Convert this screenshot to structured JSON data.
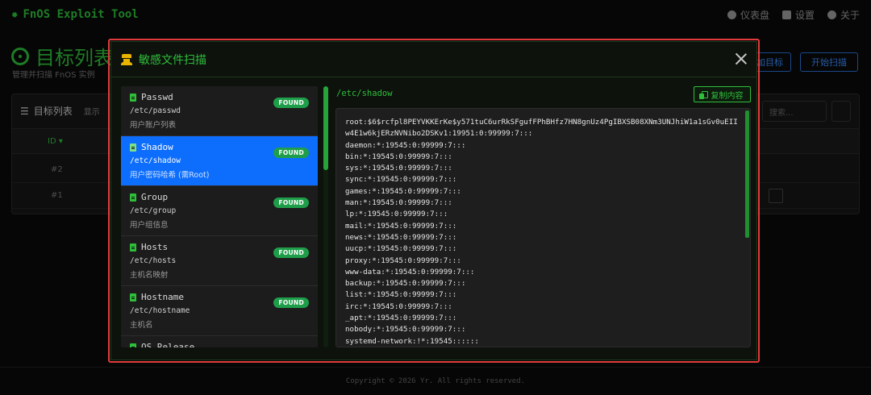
{
  "app": {
    "brand": "FnOS Exploit Tool",
    "nav": [
      {
        "label": "仪表盘",
        "icon": "dashboard-icon"
      },
      {
        "label": "设置",
        "icon": "gear-icon"
      },
      {
        "label": "关于",
        "icon": "info-icon"
      }
    ]
  },
  "page": {
    "title": "目标列表",
    "subtitle": "管理并扫描 FnOS 实例",
    "add_target_button": "添加目标",
    "start_scan_button": "开始扫描"
  },
  "panel": {
    "title": "目标列表",
    "show_label": "显示",
    "search_placeholder": "搜索...",
    "id_header": "ID ▾",
    "rows": [
      "#2",
      "#1"
    ]
  },
  "footer": {
    "copyright": "Copyright © 2026 Yr. All rights reserved."
  },
  "modal": {
    "title": "敏感文件扫描",
    "selected_path": "/etc/shadow",
    "copy_button": "复制内容",
    "files": [
      {
        "name": "Passwd",
        "path": "/etc/passwd",
        "desc": "用户账户列表",
        "status": "FOUND",
        "active": false
      },
      {
        "name": "Shadow",
        "path": "/etc/shadow",
        "desc": "用户密码哈希 (需Root)",
        "status": "FOUND",
        "active": true
      },
      {
        "name": "Group",
        "path": "/etc/group",
        "desc": "用户组信息",
        "status": "FOUND",
        "active": false
      },
      {
        "name": "Hosts",
        "path": "/etc/hosts",
        "desc": "主机名映射",
        "status": "FOUND",
        "active": false
      },
      {
        "name": "Hostname",
        "path": "/etc/hostname",
        "desc": "主机名",
        "status": "FOUND",
        "active": false
      },
      {
        "name": "OS Release",
        "path": "",
        "desc": "",
        "status": "",
        "active": false
      }
    ],
    "content_lines": [
      "root:$6$rcfpl8PEYVKKErKe$y571tuC6urRkSFgufFPhBHfz7HN8gnUz4PgIBXSB08XNm3UNJhiW1a1sGv0uEIIw4E1w6kjERzNVNibo2DSKv1:19951:0:99999:7:::",
      "daemon:*:19545:0:99999:7:::",
      "bin:*:19545:0:99999:7:::",
      "sys:*:19545:0:99999:7:::",
      "sync:*:19545:0:99999:7:::",
      "games:*:19545:0:99999:7:::",
      "man:*:19545:0:99999:7:::",
      "lp:*:19545:0:99999:7:::",
      "mail:*:19545:0:99999:7:::",
      "news:*:19545:0:99999:7:::",
      "uucp:*:19545:0:99999:7:::",
      "proxy:*:19545:0:99999:7:::",
      "www-data:*:19545:0:99999:7:::",
      "backup:*:19545:0:99999:7:::",
      "list:*:19545:0:99999:7:::",
      "irc:*:19545:0:99999:7:::",
      "_apt:*:19545:0:99999:7:::",
      "nobody:*:19545:0:99999:7:::",
      "systemd-network:!*:19545::::::"
    ]
  },
  "colors": {
    "accent_green": "#2fbf3a",
    "active_blue": "#0d6efd",
    "highlight_red": "#e23b3b",
    "badge_green": "#1f9e4a"
  }
}
